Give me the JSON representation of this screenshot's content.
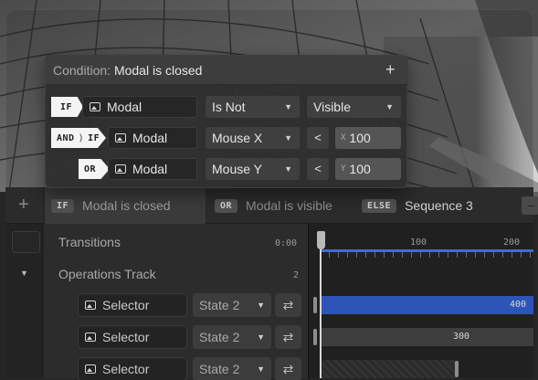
{
  "condition_popover": {
    "title_key": "Condition:",
    "title_value": "Modal is closed",
    "add_icon": "plus-icon",
    "rows": [
      {
        "operator": "IF",
        "target": "Modal",
        "comparison": "Is Not",
        "value": "Visible"
      },
      {
        "operator_and": "AND",
        "operator": "IF",
        "target": "Modal",
        "property": "Mouse X",
        "compare": "<",
        "axis": "X",
        "number": "100"
      },
      {
        "operator": "OR",
        "target": "Modal",
        "property": "Mouse Y",
        "compare": "<",
        "axis": "Y",
        "number": "100"
      }
    ]
  },
  "tabs": {
    "add_label": "+",
    "items": [
      {
        "badge": "IF",
        "label": "Modal is closed",
        "active": true
      },
      {
        "badge": "OR",
        "label": "Modal is visible"
      },
      {
        "badge": "ELSE",
        "label": "Sequence 3"
      }
    ]
  },
  "tracks": {
    "transitions": {
      "label": "Transitions",
      "time": "0:00"
    },
    "operations": {
      "label": "Operations Track",
      "count": "2"
    },
    "rows": [
      {
        "target": "Selector",
        "state": "State 2",
        "swap_icon": "swap-icon",
        "bar_value": "400"
      },
      {
        "target": "Selector",
        "state": "State 2",
        "swap_icon": "swap-icon",
        "bar_value": "300"
      },
      {
        "target": "Selector",
        "state": "State 2",
        "swap_icon": "swap-icon"
      }
    ]
  },
  "ruler": {
    "ticks": [
      "100",
      "200"
    ]
  },
  "colors": {
    "accent_blue": "#2d55b8",
    "ruler_blue": "#3f6bd6",
    "tag_white": "#f4f4f4"
  }
}
